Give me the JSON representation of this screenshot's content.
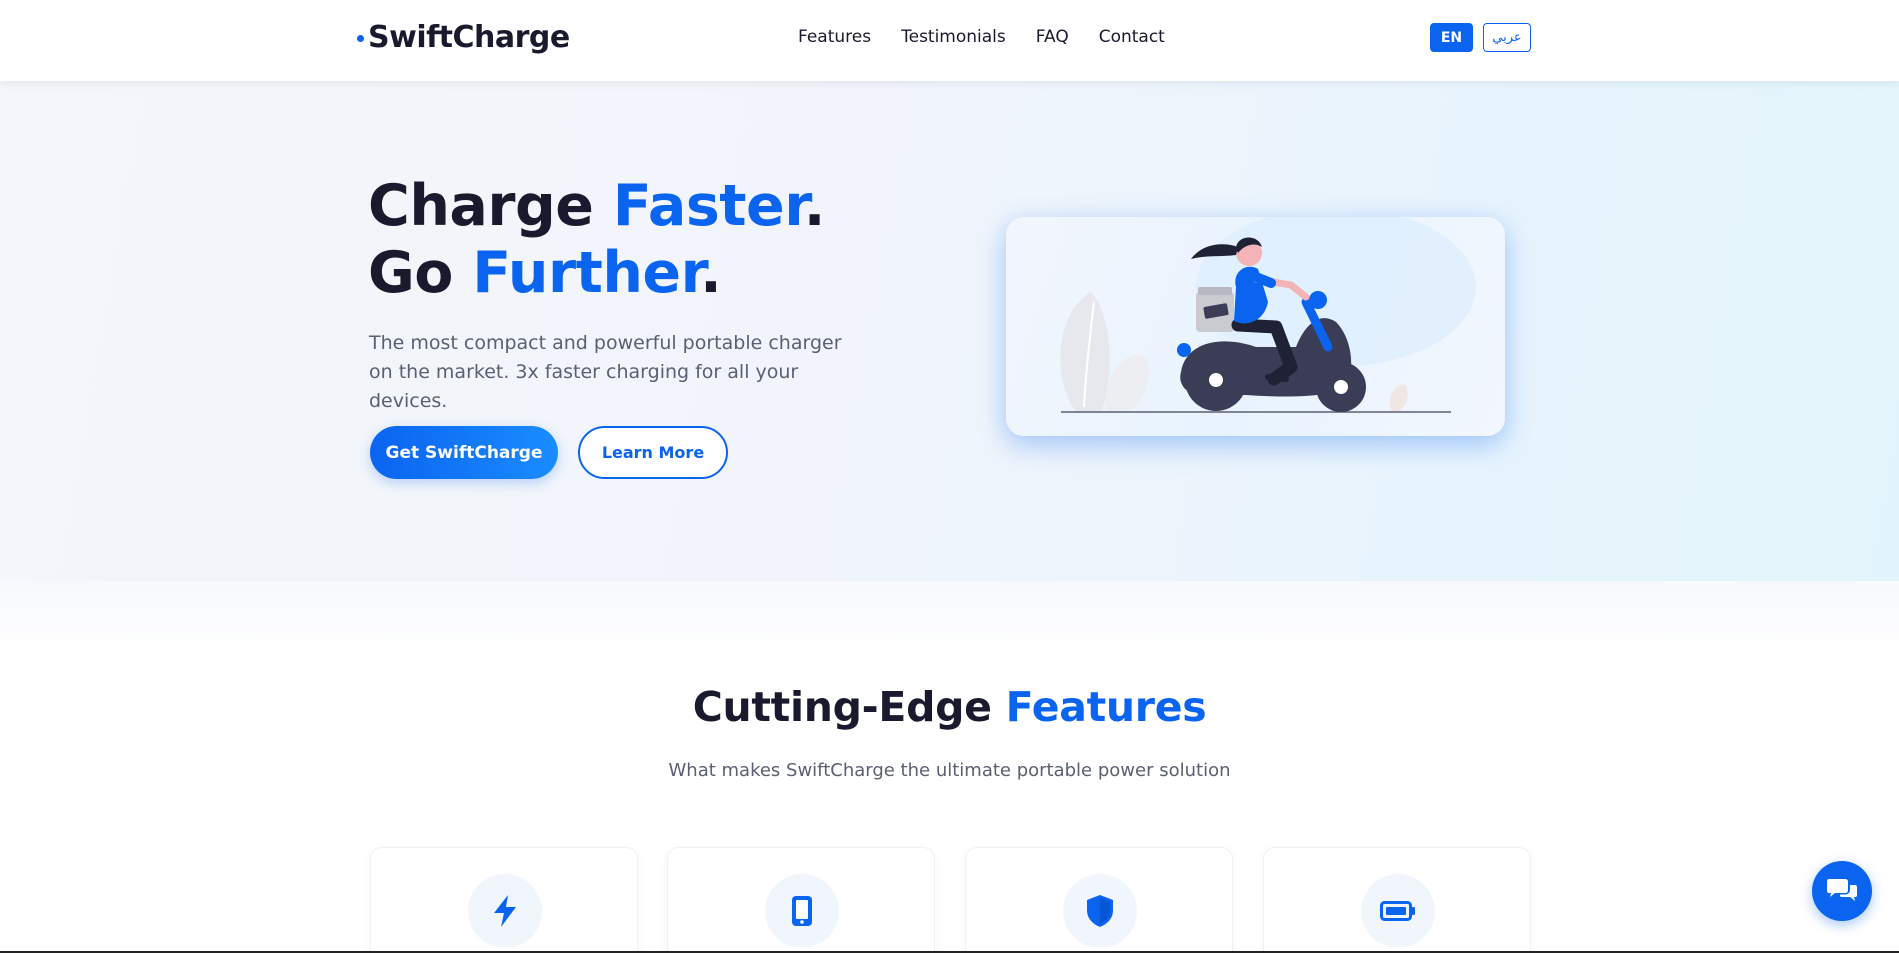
{
  "brand": {
    "name": "SwiftCharge"
  },
  "nav": {
    "links": [
      {
        "label": "Features"
      },
      {
        "label": "Testimonials"
      },
      {
        "label": "FAQ"
      },
      {
        "label": "Contact"
      }
    ],
    "languages": {
      "en": "EN",
      "ar": "عربي",
      "active": "EN"
    }
  },
  "hero": {
    "title_line1_part1": "Charge ",
    "title_line1_accent": "Faster",
    "title_line1_end": ".",
    "title_line2_part1": "Go ",
    "title_line2_accent": "Further",
    "title_line2_end": ".",
    "subtitle": "The most compact and powerful portable charger on the market. 3x faster charging for all your devices.",
    "primary_cta": "Get SwiftCharge",
    "secondary_cta": "Learn More"
  },
  "features": {
    "title_part1": "Cutting-Edge ",
    "title_accent": "Features",
    "subtitle": "What makes SwiftCharge the ultimate portable power solution",
    "cards": [
      {
        "icon": "lightning-icon"
      },
      {
        "icon": "phone-icon"
      },
      {
        "icon": "shield-icon"
      },
      {
        "icon": "battery-icon"
      }
    ]
  },
  "chat": {
    "icon": "chat-bubbles-icon"
  },
  "colors": {
    "accent": "#0a64f0",
    "text_dark": "#1a1a2e",
    "text_muted": "#5a6072"
  }
}
